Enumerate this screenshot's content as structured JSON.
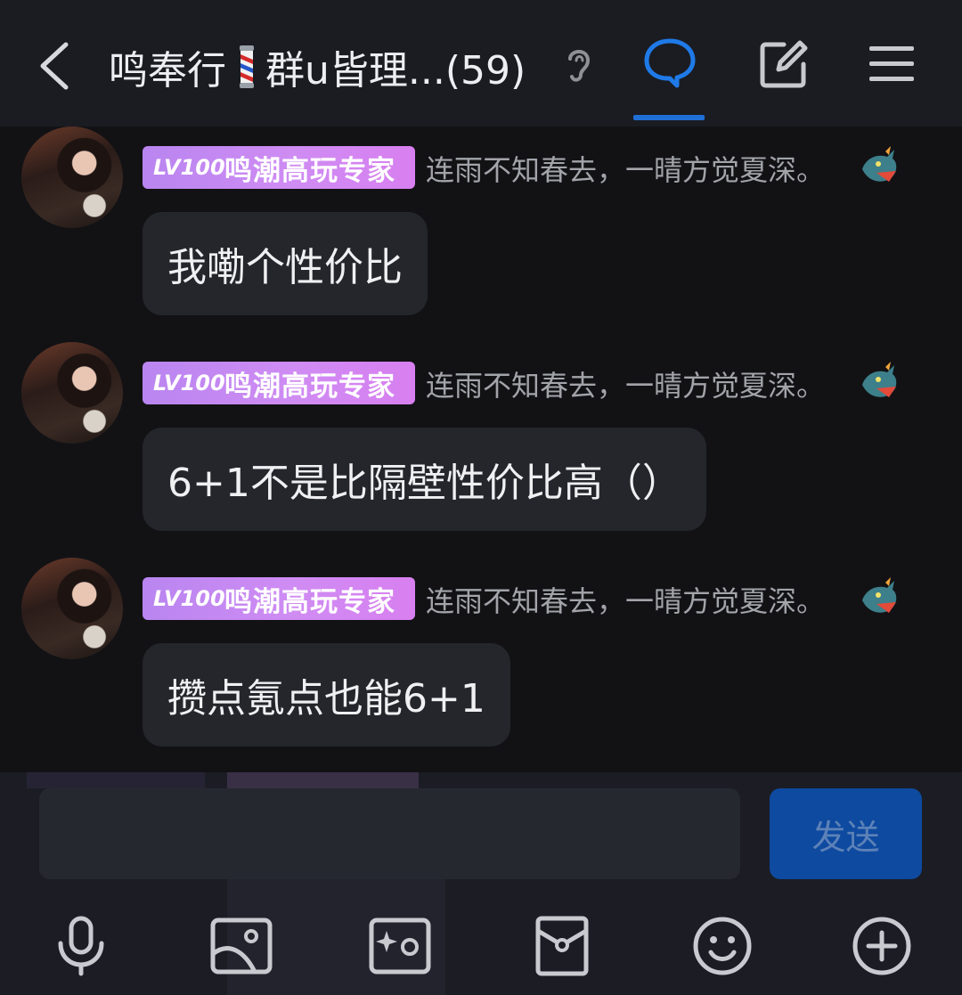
{
  "header": {
    "title_prefix": "鸣奉行",
    "title_suffix": "群u皆理...(59)",
    "send_color": "#1f6fd6"
  },
  "messages": [
    {
      "badge_level": "LV100",
      "badge_rank": "鸣潮高玩专家",
      "signature": "连雨不知春去，一晴方觉夏深。",
      "text": "我嘞个性价比"
    },
    {
      "badge_level": "LV100",
      "badge_rank": "鸣潮高玩专家",
      "signature": "连雨不知春去，一晴方觉夏深。",
      "text": "6+1不是比隔壁性价比高（）"
    },
    {
      "badge_level": "LV100",
      "badge_rank": "鸣潮高玩专家",
      "signature": "连雨不知春去，一晴方觉夏深。",
      "text": "攒点氪点也能6+1"
    }
  ],
  "composer": {
    "input_value": "",
    "send_label": "发送"
  },
  "toolbar": {
    "icons": [
      "microphone-icon",
      "image-icon",
      "sparkle-image-icon",
      "red-packet-icon",
      "emoji-icon",
      "plus-icon"
    ]
  }
}
